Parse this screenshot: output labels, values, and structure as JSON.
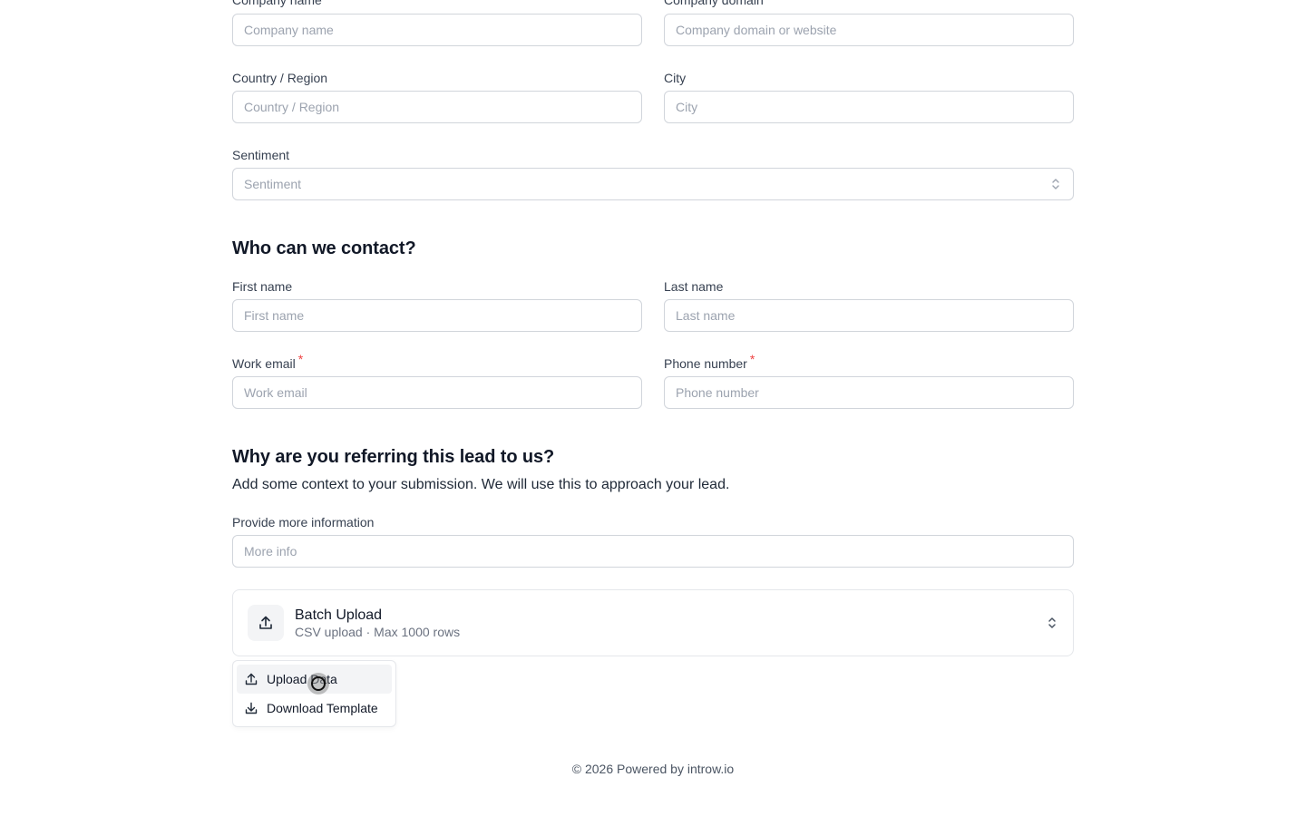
{
  "company": {
    "name_label": "Company name",
    "name_placeholder": "Company name",
    "domain_label": "Company domain",
    "domain_placeholder": "Company domain or website",
    "country_label": "Country / Region",
    "country_placeholder": "Country / Region",
    "city_label": "City",
    "city_placeholder": "City",
    "sentiment_label": "Sentiment",
    "sentiment_placeholder": "Sentiment"
  },
  "contact": {
    "heading": "Who can we contact?",
    "first_label": "First name",
    "first_placeholder": "First name",
    "last_label": "Last name",
    "last_placeholder": "Last name",
    "email_label": "Work email",
    "email_placeholder": "Work email",
    "phone_label": "Phone number",
    "phone_placeholder": "Phone number",
    "required_mark": "*"
  },
  "referral": {
    "heading": "Why are you referring this lead to us?",
    "subtitle": "Add some context to your submission. We will use this to approach your lead.",
    "info_label": "Provide more information",
    "info_placeholder": "More info"
  },
  "batch": {
    "title": "Batch Upload",
    "description": "CSV upload · Max 1000 rows",
    "menu": [
      {
        "label": "Upload Data",
        "icon": "upload-icon"
      },
      {
        "label": "Download Template",
        "icon": "download-icon"
      }
    ]
  },
  "footer": {
    "text": "© 2026 Powered by introw.io"
  },
  "colors": {
    "required": "#ef4444",
    "border": "#d1d5db",
    "placeholder": "#9ca3af"
  }
}
